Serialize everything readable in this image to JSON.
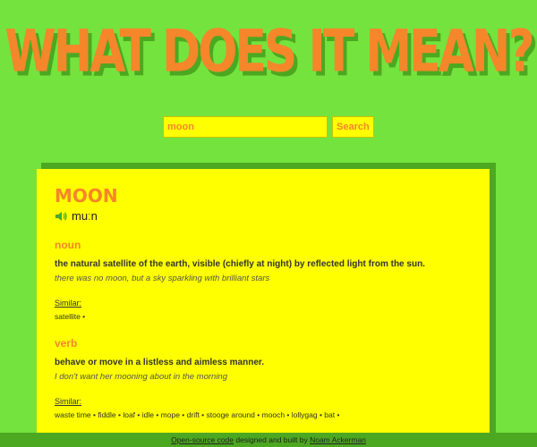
{
  "header": {
    "title": "WHAT DOES IT MEAN?"
  },
  "search": {
    "value": "moon",
    "button_label": "Search"
  },
  "result": {
    "word": "MOON",
    "phonetic": "muːn",
    "meanings": [
      {
        "part_of_speech": "noun",
        "definition": "the natural satellite of the earth, visible (chiefly at night) by reflected light from the sun.",
        "example": "there was no moon, but a sky sparkling with brilliant stars",
        "similar_label": "Similar:",
        "similar": "satellite •"
      },
      {
        "part_of_speech": "verb",
        "definition": "behave or move in a listless and aimless manner.",
        "example": "I don't want her mooning about in the morning",
        "similar_label": "Similar:",
        "similar": "waste time • fiddle • loaf • idle • mope • drift • stooge around • mooch • lollygag • bat •"
      }
    ]
  },
  "footer": {
    "source_link": "Open-source code",
    "middle_text": " designed and built by ",
    "author_link": "Noam Ackerman"
  },
  "colors": {
    "background": "#74e33d",
    "accent": "#f5862a",
    "card": "#ffff00",
    "shadow": "#4da821"
  }
}
